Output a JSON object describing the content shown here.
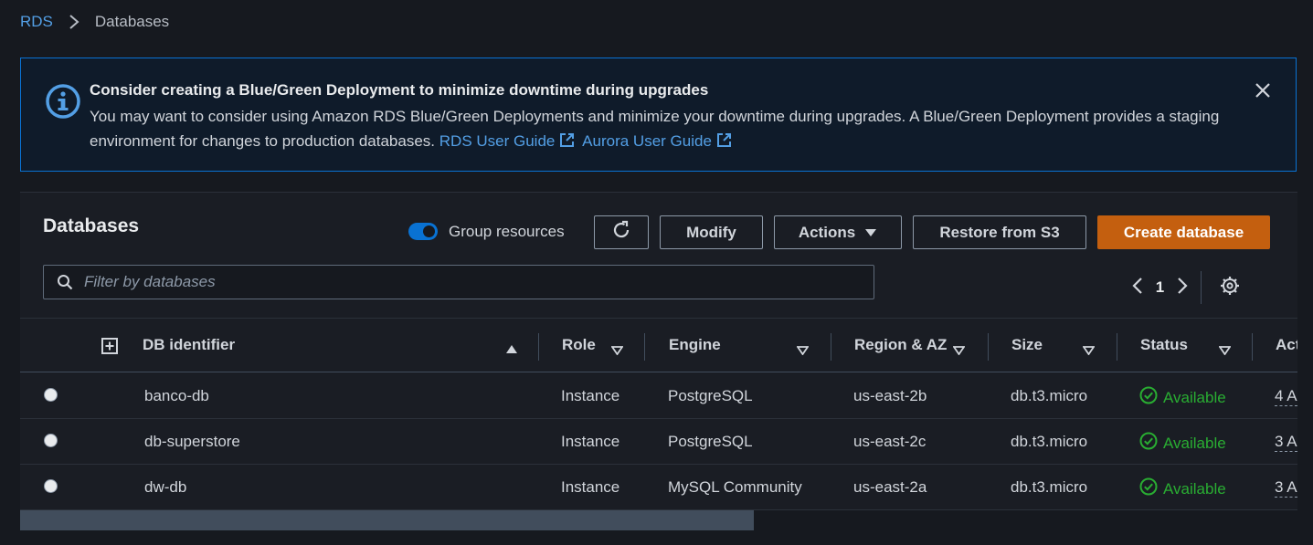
{
  "breadcrumb": {
    "root": "RDS",
    "current": "Databases"
  },
  "alert": {
    "title": "Consider creating a Blue/Green Deployment to minimize downtime during upgrades",
    "body": "You may want to consider using Amazon RDS Blue/Green Deployments and minimize your downtime during upgrades. A Blue/Green Deployment provides a staging environment for changes to production databases.",
    "link_rds": "RDS User Guide",
    "link_aurora": "Aurora User Guide"
  },
  "panel": {
    "title": "Databases",
    "group_resources_label": "Group resources",
    "group_resources_on": true,
    "buttons": {
      "modify": "Modify",
      "actions": "Actions",
      "restore": "Restore from S3",
      "create": "Create database"
    },
    "filter_placeholder": "Filter by databases",
    "page": "1"
  },
  "table": {
    "headers": {
      "id": "DB identifier",
      "role": "Role",
      "engine": "Engine",
      "region": "Region & AZ",
      "size": "Size",
      "status": "Status",
      "actions": "Act"
    },
    "rows": [
      {
        "id": "banco-db",
        "role": "Instance",
        "engine": "PostgreSQL",
        "region": "us-east-2b",
        "size": "db.t3.micro",
        "status": "Available",
        "actions": "4 A"
      },
      {
        "id": "db-superstore",
        "role": "Instance",
        "engine": "PostgreSQL",
        "region": "us-east-2c",
        "size": "db.t3.micro",
        "status": "Available",
        "actions": "3 A"
      },
      {
        "id": "dw-db",
        "role": "Instance",
        "engine": "MySQL Community",
        "region": "us-east-2a",
        "size": "db.t3.micro",
        "status": "Available",
        "actions": "3 A"
      }
    ]
  },
  "colors": {
    "accent": "#0972d3",
    "link": "#539fe5",
    "primary": "#c45f0f",
    "success": "#29ad32"
  }
}
